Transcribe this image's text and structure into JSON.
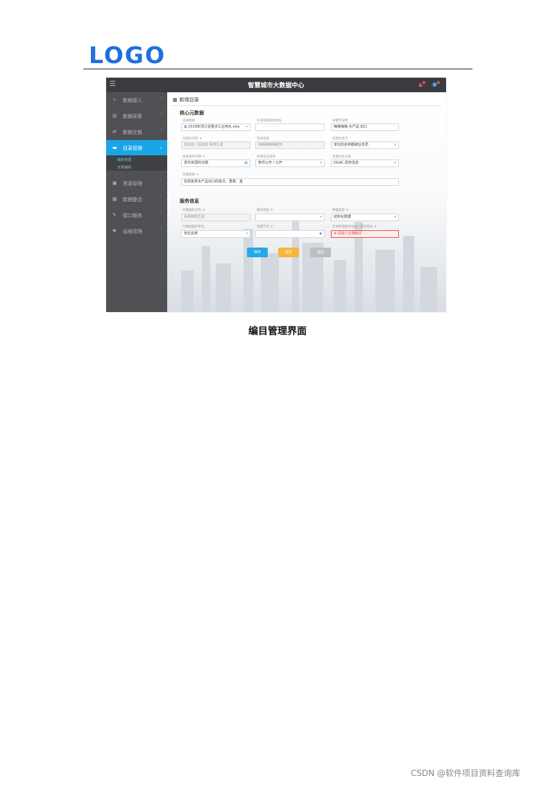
{
  "logo": "LOGO",
  "screenshot": {
    "app_title": "智慧城市大数据中心",
    "sidebar": {
      "items": [
        {
          "icon": "link-icon",
          "glyph": "✧",
          "label": "数据接入"
        },
        {
          "icon": "database-icon",
          "glyph": "▤",
          "label": "数据采集"
        },
        {
          "icon": "exchange-icon",
          "glyph": "⇄",
          "label": "数据交换"
        },
        {
          "icon": "folder-icon",
          "glyph": "▬",
          "label": "目录管理"
        },
        {
          "icon": "resource-icon",
          "glyph": "▣",
          "label": "资源管理"
        },
        {
          "icon": "integrate-icon",
          "glyph": "▦",
          "label": "数据整合"
        },
        {
          "icon": "api-icon",
          "glyph": "✎",
          "label": "接口服务"
        },
        {
          "icon": "wrench-icon",
          "glyph": "✚",
          "label": "运维管理"
        }
      ],
      "subitems": [
        "编目管理",
        "目录编制"
      ]
    },
    "page_title": "新增目录",
    "section_core": "核心元数据",
    "section_service": "服务信息",
    "core_fields": [
      {
        "label": "选择数据",
        "value": "2018年浙江省重点工业用水.xlsx"
      },
      {
        "label": "在线资源链接地址",
        "value": ""
      },
      {
        "label": "关键字说明",
        "value": "梅梅梅梅 水产品 出口"
      },
      {
        "label": "资源标识符",
        "value": "前前前 / 后前前 系统生成"
      },
      {
        "label": "资源名称",
        "value": "梅梅梅梅梅服务"
      },
      {
        "label": "资源负责方",
        "value": "单位的名称都被业务员"
      },
      {
        "label": "资源发布日期",
        "value": "发布资源的日期"
      },
      {
        "label": "资源安全级别",
        "value": "条件公开 / 公开"
      },
      {
        "label": "资源信息分类",
        "value": "DGAC 政务信息"
      },
      {
        "label": "资源摘要",
        "value": "包括各类水产品出口的批次、重量、金"
      }
    ],
    "service_fields": [
      {
        "label": "元数据标识符",
        "value": "系统随机生成"
      },
      {
        "label": "服务类型",
        "value": ""
      },
      {
        "label": "数据类型",
        "value": "结构化数据"
      },
      {
        "label": "元数据维护单位",
        "value": "单位名称"
      },
      {
        "label": "到期节点",
        "value": ""
      },
      {
        "label": "在线资源服务地址 / 服务地址",
        "value": "请输入正确格式"
      }
    ],
    "buttons": {
      "save": "保存",
      "submit": "提交",
      "back": "返回"
    }
  },
  "caption": "编目管理界面",
  "watermark": "CSDN @软件项目资料查询库"
}
